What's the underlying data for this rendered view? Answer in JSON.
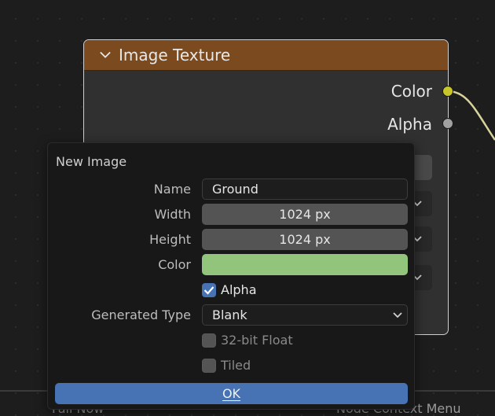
{
  "node": {
    "title": "Image Texture",
    "outputs": [
      {
        "label": "Color",
        "socket_color": "#c7c729"
      },
      {
        "label": "Alpha",
        "socket_color": "#a1a1a1"
      }
    ],
    "header_color": "#7b4b1f"
  },
  "bottom_bar": {
    "left_text": "Fail Now",
    "right_text": "Node Context Menu"
  },
  "dialog": {
    "title": "New Image",
    "name": {
      "label": "Name",
      "value": "Ground"
    },
    "width": {
      "label": "Width",
      "value": "1024 px"
    },
    "height": {
      "label": "Height",
      "value": "1024 px"
    },
    "color": {
      "label": "Color",
      "value": "#93c47b"
    },
    "alpha": {
      "label": "Alpha",
      "checked": true
    },
    "generated_type": {
      "label": "Generated Type",
      "value": "Blank"
    },
    "float32": {
      "label": "32-bit Float",
      "checked": false
    },
    "tiled": {
      "label": "Tiled",
      "checked": false
    },
    "ok_label": "OK",
    "accent": "#4772b3"
  }
}
